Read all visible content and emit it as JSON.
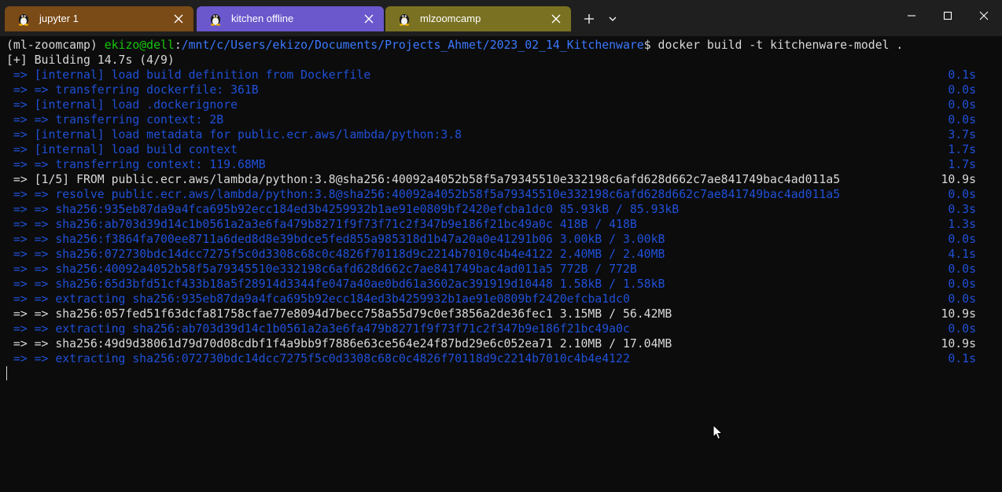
{
  "tabs": [
    {
      "label": "jupyter 1",
      "icon": "linux-penguin-icon",
      "color": "#7a4a17"
    },
    {
      "label": "kitchen offline",
      "icon": "linux-penguin-icon",
      "color": "#6a58cc"
    },
    {
      "label": "mlzoomcamp",
      "icon": "linux-penguin-icon",
      "color": "#7a7222"
    }
  ],
  "titlebar": {
    "new_tab_icon": "plus-icon",
    "dropdown_icon": "chevron-down-icon",
    "controls": [
      "minimize-icon",
      "maximize-icon",
      "close-icon"
    ]
  },
  "prompt": {
    "env": "(ml-zoomcamp) ",
    "user_host": "ekizo@dell",
    "colon": ":",
    "path": "/mnt/c/Users/ekizo/Documents/Projects_Ahmet/2023_02_14_Kitchenware",
    "symbol": "$ ",
    "command": "docker build -t kitchenware-model ."
  },
  "building": "[+] Building 14.7s (4/9)",
  "lines": [
    {
      "text": " => [internal] load build definition from Dockerfile",
      "time": "0.1s",
      "color": "blue"
    },
    {
      "text": " => => transferring dockerfile: 361B",
      "time": "0.0s",
      "color": "blue"
    },
    {
      "text": " => [internal] load .dockerignore",
      "time": "0.0s",
      "color": "blue"
    },
    {
      "text": " => => transferring context: 2B",
      "time": "0.0s",
      "color": "blue"
    },
    {
      "text": " => [internal] load metadata for public.ecr.aws/lambda/python:3.8",
      "time": "3.7s",
      "color": "blue"
    },
    {
      "text": " => [internal] load build context",
      "time": "1.7s",
      "color": "blue"
    },
    {
      "text": " => => transferring context: 119.68MB",
      "time": "1.7s",
      "color": "blue"
    },
    {
      "text": " => [1/5] FROM public.ecr.aws/lambda/python:3.8@sha256:40092a4052b58f5a79345510e332198c6afd628d662c7ae841749bac4ad011a5",
      "time": "10.9s",
      "color": "white"
    },
    {
      "text": " => => resolve public.ecr.aws/lambda/python:3.8@sha256:40092a4052b58f5a79345510e332198c6afd628d662c7ae841749bac4ad011a5",
      "time": "0.0s",
      "color": "blue"
    },
    {
      "text": " => => sha256:935eb87da9a4fca695b92ecc184ed3b4259932b1ae91e0809bf2420efcba1dc0 85.93kB / 85.93kB",
      "time": "0.3s",
      "color": "blue"
    },
    {
      "text": " => => sha256:ab703d39d14c1b0561a2a3e6fa479b8271f9f73f71c2f347b9e186f21bc49a0c 418B / 418B",
      "time": "1.3s",
      "color": "blue"
    },
    {
      "text": " => => sha256:f3864fa700ee8711a6ded8d8e39bdce5fed855a985318d1b47a20a0e41291b06 3.00kB / 3.00kB",
      "time": "0.0s",
      "color": "blue"
    },
    {
      "text": " => => sha256:072730bdc14dcc7275f5c0d3308c68c0c4826f70118d9c2214b7010c4b4e4122 2.40MB / 2.40MB",
      "time": "4.1s",
      "color": "blue"
    },
    {
      "text": " => => sha256:40092a4052b58f5a79345510e332198c6afd628d662c7ae841749bac4ad011a5 772B / 772B",
      "time": "0.0s",
      "color": "blue"
    },
    {
      "text": " => => sha256:65d3bfd51cf433b18a5f28914d3344fe047a40ae0bd61a3602ac391919d10448 1.58kB / 1.58kB",
      "time": "0.0s",
      "color": "blue"
    },
    {
      "text": " => => extracting sha256:935eb87da9a4fca695b92ecc184ed3b4259932b1ae91e0809bf2420efcba1dc0",
      "time": "0.0s",
      "color": "blue"
    },
    {
      "text": " => => sha256:057fed51f63dcfa81758cfae77e8094d7becc758a55d79c0ef3856a2de36fec1 3.15MB / 56.42MB",
      "time": "10.9s",
      "color": "white"
    },
    {
      "text": " => => extracting sha256:ab703d39d14c1b0561a2a3e6fa479b8271f9f73f71c2f347b9e186f21bc49a0c",
      "time": "0.0s",
      "color": "blue"
    },
    {
      "text": " => => sha256:49d9d38061d79d70d08cdbf1f4a9bb9f7886e63ce564e24f87bd29e6c052ea71 2.10MB / 17.04MB",
      "time": "10.9s",
      "color": "white"
    },
    {
      "text": " => => extracting sha256:072730bdc14dcc7275f5c0d3308c68c0c4826f70118d9c2214b7010c4b4e4122",
      "time": "0.1s",
      "color": "blue"
    }
  ],
  "colors": {
    "background": "#0c0c0c",
    "titlebar": "#1f1f1f",
    "blue": "#1f50d8",
    "white": "#d8d8d8",
    "green": "#16c60c",
    "path": "#3b78ff"
  }
}
